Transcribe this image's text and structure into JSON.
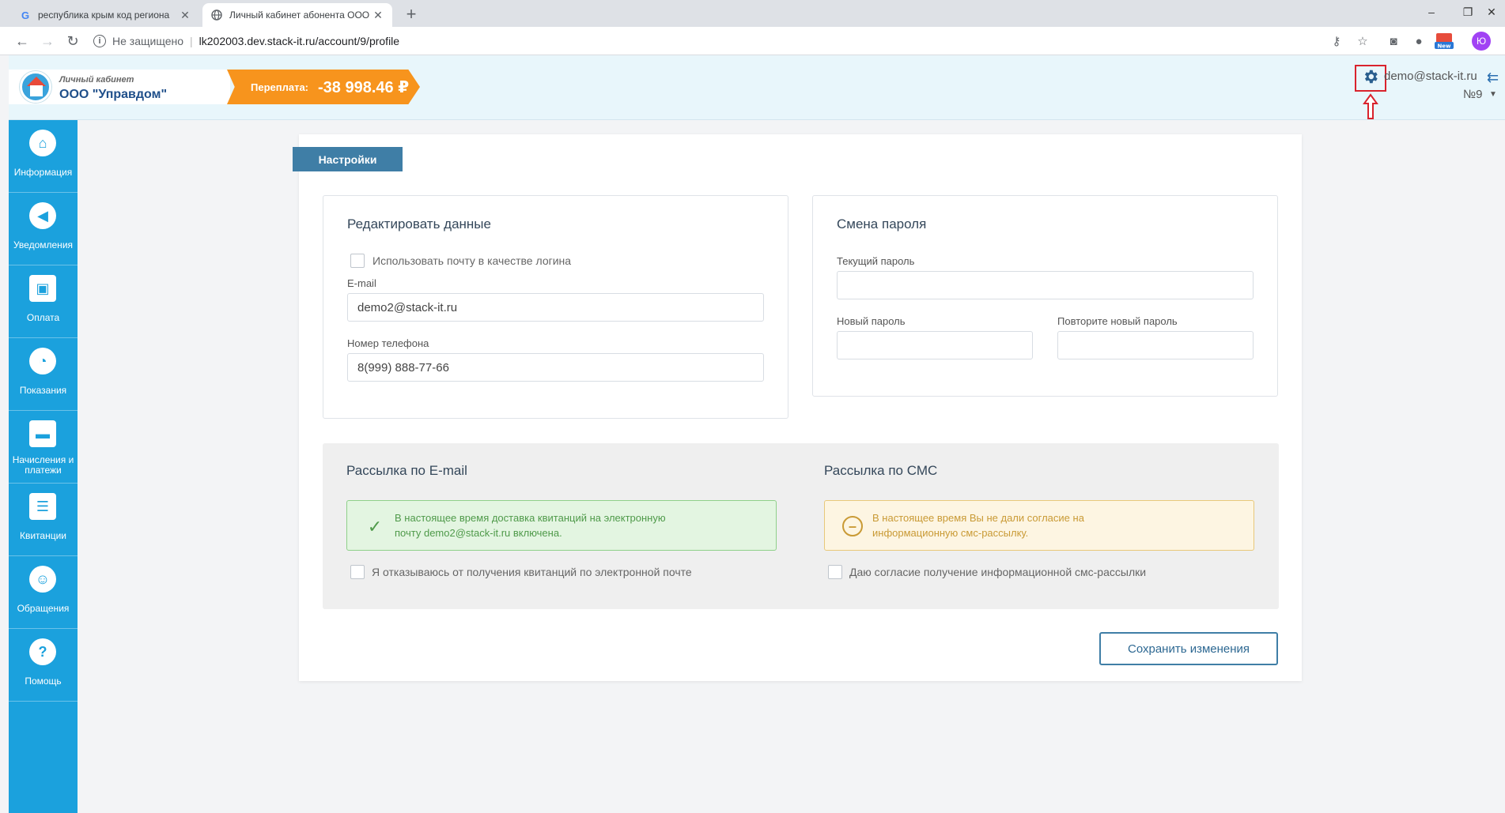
{
  "browser": {
    "tabs": [
      {
        "title": "республика крым код региона",
        "favicon": "google-icon",
        "active": false
      },
      {
        "title": "Личный кабинет абонента ООО",
        "favicon": "globe-icon",
        "active": true
      }
    ],
    "new_tab": "+",
    "security_text": "Не защищено",
    "url": "lk202003.dev.stack-it.ru/account/9/profile",
    "profile_initial": "Ю",
    "ext_badge": "New"
  },
  "header": {
    "brand_subtitle": "Личный кабинет",
    "brand_name": "ООО \"Управдом\"",
    "overpay_label": "Переплата:",
    "overpay_value": "-38 998.46 ₽",
    "user_email": "demo@stack-it.ru",
    "account_number": "№9"
  },
  "sidebar": {
    "items": [
      {
        "label": "Информация",
        "icon": "home-icon"
      },
      {
        "label": "Уведомления",
        "icon": "megaphone-icon"
      },
      {
        "label": "Оплата",
        "icon": "wallet-icon"
      },
      {
        "label": "Показания",
        "icon": "meter-icon"
      },
      {
        "label": "Начисления и платежи",
        "icon": "card-icon"
      },
      {
        "label": "Квитанции",
        "icon": "receipt-icon"
      },
      {
        "label": "Обращения",
        "icon": "user-chat-icon"
      },
      {
        "label": "Помощь",
        "icon": "help-icon"
      }
    ]
  },
  "settings": {
    "tab_label": "Настройки",
    "edit": {
      "title": "Редактировать данные",
      "use_email_login": "Использовать почту в качестве логина",
      "email_label": "E-mail",
      "email_value": "demo2@stack-it.ru",
      "phone_label": "Номер телефона",
      "phone_value": "8(999) 888-77-66"
    },
    "password": {
      "title": "Смена пароля",
      "current_label": "Текущий пароль",
      "new_label": "Новый пароль",
      "repeat_label": "Повторите новый пароль"
    },
    "email_mailing": {
      "title": "Рассылка по E-mail",
      "status_line1": "В настоящее время доставка квитанций на электронную",
      "status_line2": "почту demo2@stack-it.ru включена.",
      "optout_label": "Я отказываюсь от получения квитанций по электронной почте"
    },
    "sms_mailing": {
      "title": "Рассылка по СМС",
      "status_line1": "В настоящее время Вы не дали согласие на",
      "status_line2": "информационную смс-рассылку.",
      "consent_label": "Даю согласие получение информационной смс-рассылки"
    },
    "save_label": "Сохранить изменения"
  },
  "colors": {
    "sidebar": "#1ba1dd",
    "accent": "#3f7ea6",
    "overpay": "#f7941d",
    "highlight": "#d9232d"
  }
}
